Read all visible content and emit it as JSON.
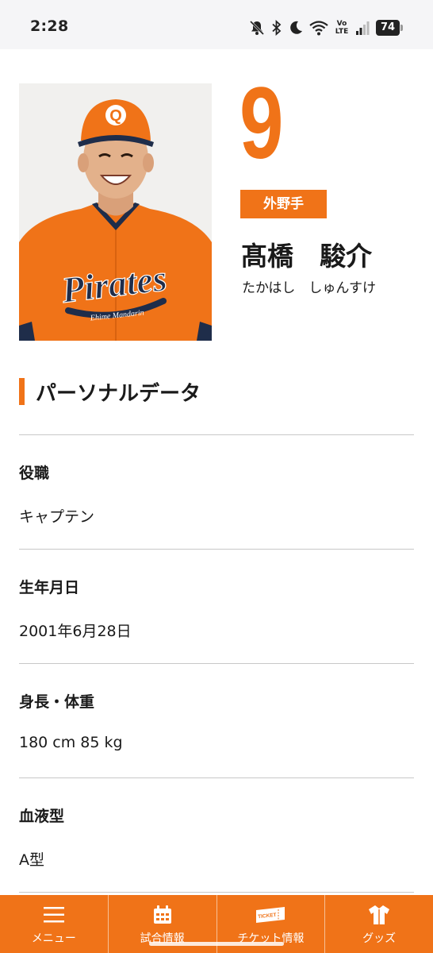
{
  "status_bar": {
    "time": "2:28",
    "network": "Vo LTE",
    "battery": "74"
  },
  "player": {
    "number": "9",
    "position": "外野手",
    "name": "髙橋　駿介",
    "kana": "たかはし　しゅんすけ",
    "photo": {
      "jersey_text": "Pirates",
      "jersey_subtext": "Ehime Mandarin",
      "cap_letter": "Q",
      "jersey_color": "#f07318"
    }
  },
  "section": {
    "title": "パーソナルデータ"
  },
  "personal_data": [
    {
      "label": "役職",
      "value": "キャプテン"
    },
    {
      "label": "生年月日",
      "value": "2001年6月28日"
    },
    {
      "label": "身長・体重",
      "value": "180 cm 85 kg"
    },
    {
      "label": "血液型",
      "value": "A型"
    }
  ],
  "bottom_nav": [
    {
      "label": "メニュー",
      "icon": "menu-icon"
    },
    {
      "label": "試合情報",
      "icon": "calendar-icon"
    },
    {
      "label": "チケット情報",
      "icon": "ticket-icon",
      "icon_text": "TICKET"
    },
    {
      "label": "グッズ",
      "icon": "shirt-icon"
    }
  ],
  "colors": {
    "accent": "#f07318",
    "text": "#1a1a1a",
    "divider": "#c8c8c8"
  }
}
